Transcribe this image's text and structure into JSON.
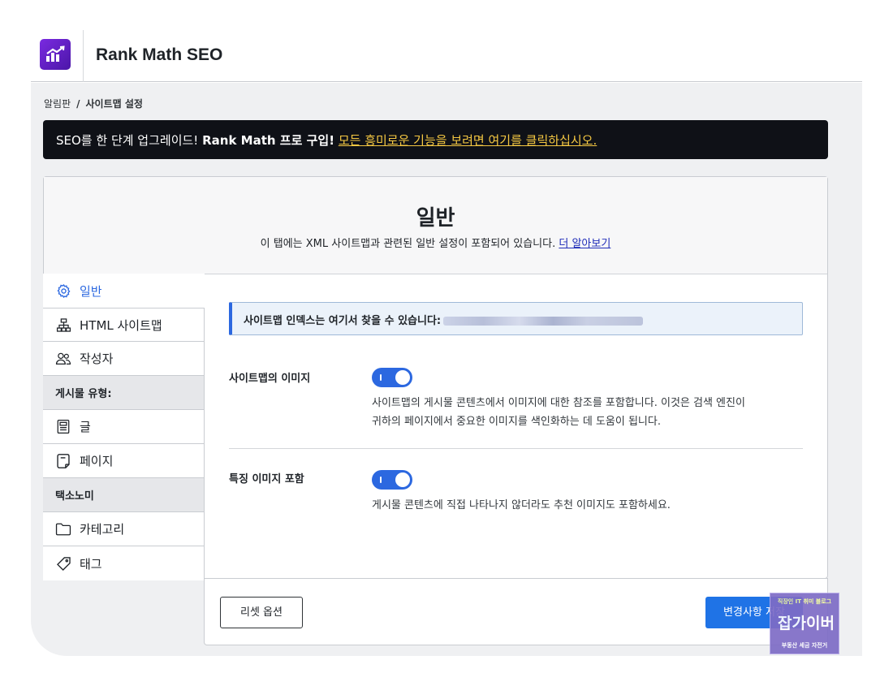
{
  "app": {
    "title": "Rank Math SEO"
  },
  "breadcrumb": {
    "parent": "알림판",
    "separator": "/",
    "current": "사이트맵 설정"
  },
  "promo": {
    "lead": "SEO를 한 단계 업그레이드!",
    "bold": "Rank Math 프로 구입!",
    "link": "모든 흥미로운 기능을 보려면 여기를 클릭하십시오."
  },
  "header": {
    "title": "일반",
    "description": "이 탭에는 XML 사이트맵과 관련된 일반 설정이 포함되어 있습니다.",
    "learn_more": "더 알아보기"
  },
  "sidebar": {
    "items": [
      {
        "label": "일반",
        "icon": "gear-icon",
        "active": true
      },
      {
        "label": "HTML 사이트맵",
        "icon": "sitemap-icon"
      },
      {
        "label": "작성자",
        "icon": "users-icon"
      }
    ],
    "post_types_heading": "게시물 유형:",
    "post_types": [
      {
        "label": "글",
        "icon": "document-icon"
      },
      {
        "label": "페이지",
        "icon": "page-icon"
      }
    ],
    "taxonomy_heading": "택소노미",
    "taxonomies": [
      {
        "label": "카테고리",
        "icon": "folder-icon"
      },
      {
        "label": "태그",
        "icon": "tag-icon"
      }
    ]
  },
  "sitemap_index": {
    "label": "사이트맵 인덱스는 여기서 찾을 수 있습니다:"
  },
  "options": [
    {
      "label": "사이트맵의 이미지",
      "enabled": true,
      "desc_line1": "사이트맵의 게시물 콘텐츠에서 이미지에 대한 참조를 포함합니다. 이것은 검색 엔진이",
      "desc_line2": "귀하의 페이지에서 중요한 이미지를 색인화하는 데 도움이 됩니다."
    },
    {
      "label": "특징 이미지 포함",
      "enabled": true,
      "desc_line1": "게시물 콘텐츠에 직접 나타나지 않더라도 추천 이미지도 포함하세요."
    }
  ],
  "footer": {
    "reset_label": "리셋 옵션",
    "save_label": "변경사항 저장"
  },
  "watermark": {
    "top": "직장인 IT 취미 블로그",
    "brand": "잡가이버",
    "bottom": "부동산 세금 자전거"
  },
  "colors": {
    "accent": "#2c68e0",
    "promo_link": "#f5c842",
    "save_button": "#1f73e6",
    "logo": "#6a22d0"
  }
}
